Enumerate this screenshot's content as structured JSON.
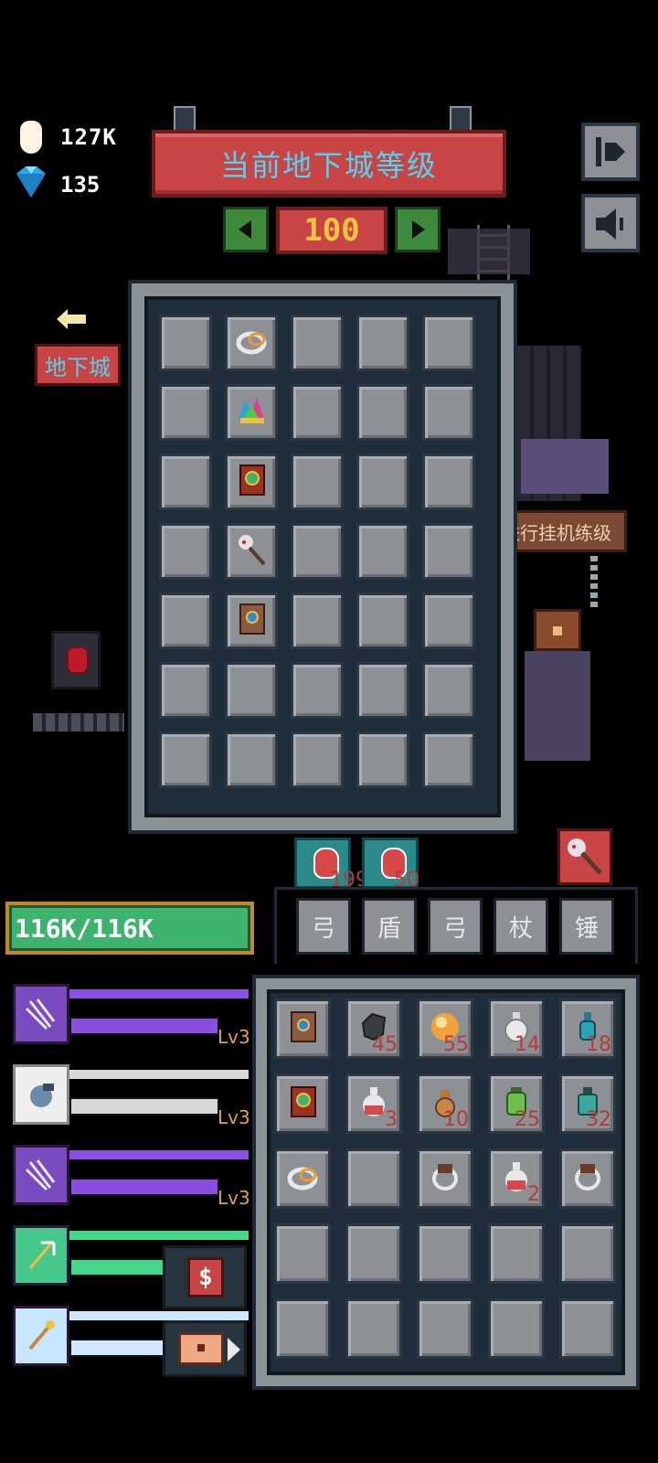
{
  "resources": {
    "gold_amount": "127K",
    "gem_amount": "135"
  },
  "dungeon": {
    "banner_title": "当前地下城等级",
    "level": "100"
  },
  "nav": {
    "dungeon_label": "地下城",
    "idle_label": "进行挂机练级"
  },
  "health": {
    "text": "116K/116K"
  },
  "equipment_grid": {
    "rows": 7,
    "cols": 5,
    "items": [
      {
        "row": 0,
        "col": 1,
        "icon": "ring-icon"
      },
      {
        "row": 1,
        "col": 1,
        "icon": "jester-hat-icon"
      },
      {
        "row": 2,
        "col": 1,
        "icon": "red-spellbook-icon"
      },
      {
        "row": 3,
        "col": 1,
        "icon": "skull-staff-icon"
      },
      {
        "row": 4,
        "col": 1,
        "icon": "brown-spellbook-icon"
      }
    ]
  },
  "potions": [
    {
      "icon": "red-potion-icon",
      "count": "199"
    },
    {
      "icon": "red-potion-icon",
      "count": "50"
    }
  ],
  "weapon_tabs": [
    "弓",
    "盾",
    "弓",
    "杖",
    "锤"
  ],
  "inventory": {
    "rows": 5,
    "cols": 5,
    "items": [
      {
        "row": 0,
        "col": 0,
        "icon": "brown-spellbook-icon",
        "count": ""
      },
      {
        "row": 0,
        "col": 1,
        "icon": "coal-ore-icon",
        "count": "45"
      },
      {
        "row": 0,
        "col": 2,
        "icon": "fire-orb-icon",
        "count": "55"
      },
      {
        "row": 0,
        "col": 3,
        "icon": "white-potion-icon",
        "count": "14"
      },
      {
        "row": 0,
        "col": 4,
        "icon": "blue-flask-icon",
        "count": "18"
      },
      {
        "row": 1,
        "col": 0,
        "icon": "red-spellbook-icon",
        "count": ""
      },
      {
        "row": 1,
        "col": 1,
        "icon": "red-potion-icon",
        "count": "3"
      },
      {
        "row": 1,
        "col": 2,
        "icon": "gourd-icon",
        "count": "10"
      },
      {
        "row": 1,
        "col": 3,
        "icon": "green-jar-icon",
        "count": "25"
      },
      {
        "row": 1,
        "col": 4,
        "icon": "teal-bottle-icon",
        "count": "32"
      },
      {
        "row": 2,
        "col": 0,
        "icon": "ring-icon",
        "count": ""
      },
      {
        "row": 2,
        "col": 2,
        "icon": "dark-ring-icon",
        "count": ""
      },
      {
        "row": 2,
        "col": 3,
        "icon": "red-potion-icon",
        "count": "2"
      },
      {
        "row": 2,
        "col": 4,
        "icon": "dark-ring-icon",
        "count": ""
      }
    ]
  },
  "skills": [
    {
      "icon": "arrows-icon",
      "level": "Lv3",
      "bar_color": "#8a4fe0",
      "fill": 1.0
    },
    {
      "icon": "cannon-icon",
      "level": "Lv3",
      "bar_color": "#d8d8d8",
      "fill": 1.0
    },
    {
      "icon": "arrows-icon",
      "level": "Lv3",
      "bar_color": "#8a4fe0",
      "fill": 1.0
    },
    {
      "icon": "trident-icon",
      "level": "",
      "bar_color": "#46d68a",
      "fill": 1.0
    },
    {
      "icon": "golden-staff-icon",
      "level": "",
      "bar_color": "#d0e8ff",
      "fill": 1.0
    }
  ],
  "colors": {
    "banner_red": "#c94545",
    "banner_text": "#4fd4f2",
    "level_text": "#f3c542",
    "health_green": "#3db36e",
    "nav_green": "#3d8a3d"
  }
}
